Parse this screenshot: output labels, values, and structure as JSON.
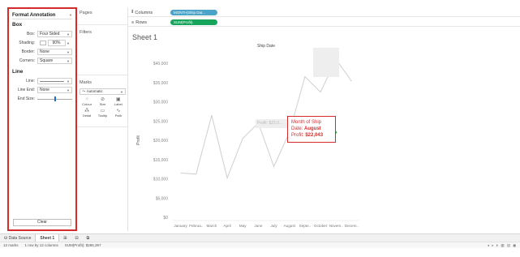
{
  "format_pane": {
    "title": "Format Annotation",
    "box_section": "Box",
    "box": {
      "label": "Box:",
      "value": "Four Sided"
    },
    "shading": {
      "label": "Shading:",
      "value": "90%"
    },
    "border": {
      "label": "Border:",
      "value": "None"
    },
    "corners": {
      "label": "Corners:",
      "value": "Square"
    },
    "line_section": "Line",
    "line": {
      "label": "Line:",
      "value": ""
    },
    "line_end": {
      "label": "Line End:",
      "value": "None"
    },
    "end_size": {
      "label": "End Size:",
      "level": 0.5
    },
    "clear_label": "Clear"
  },
  "shelves": {
    "pages": "Pages",
    "filters": "Filters",
    "marks": "Marks",
    "marks_type": "Automatic",
    "mark_buttons": [
      "Colour",
      "Size",
      "Label",
      "Detail",
      "Tooltip",
      "Path"
    ],
    "mark_icons": [
      "palette-icon",
      "size-icon",
      "label-icon",
      "detail-icon",
      "tooltip-icon",
      "path-icon"
    ]
  },
  "columns": {
    "label": "Columns",
    "pill": "MONTH(Ship Dat..."
  },
  "rows": {
    "label": "Rows",
    "pill": "SUM(Profit)"
  },
  "sheet": {
    "title": "Sheet 1"
  },
  "annotation": {
    "line1": "Month of Ship",
    "line2_label": "Date:",
    "line2_value": "August",
    "line3_label": "Profit:",
    "line3_value": "$22,043",
    "ghost_text": "Profit: $22,0..."
  },
  "tabs": {
    "data_source": "Data Source",
    "sheet1": "Sheet 1"
  },
  "status": {
    "marks": "12 marks",
    "rows_cols": "1 row by 12 columns",
    "sum": "SUM(Profit): $286,397"
  },
  "colors": {
    "accent": "#d62b2b",
    "line": "#cfcfcf",
    "columns_pill": "#4aa3c9",
    "rows_pill": "#17a55c"
  },
  "chart_data": {
    "type": "line",
    "title": "Ship Date",
    "ylabel": "Profit",
    "categories": [
      "January",
      "Februa..",
      "March",
      "April",
      "May",
      "June",
      "July",
      "August",
      "Septe..",
      "October",
      "Novem..",
      "Decem.."
    ],
    "values": [
      11500,
      11200,
      26500,
      10200,
      20500,
      24500,
      13200,
      22043,
      36500,
      32500,
      41000,
      35300
    ],
    "ylim": [
      0,
      40000
    ],
    "yticks": [
      0,
      5000,
      10000,
      15000,
      20000,
      25000,
      30000,
      35000,
      40000
    ],
    "ytick_labels": [
      "$0",
      "$5,000",
      "$10,000",
      "$15,000",
      "$20,000",
      "$25,000",
      "$30,000",
      "$35,000",
      "$40,000"
    ],
    "grid": false
  }
}
